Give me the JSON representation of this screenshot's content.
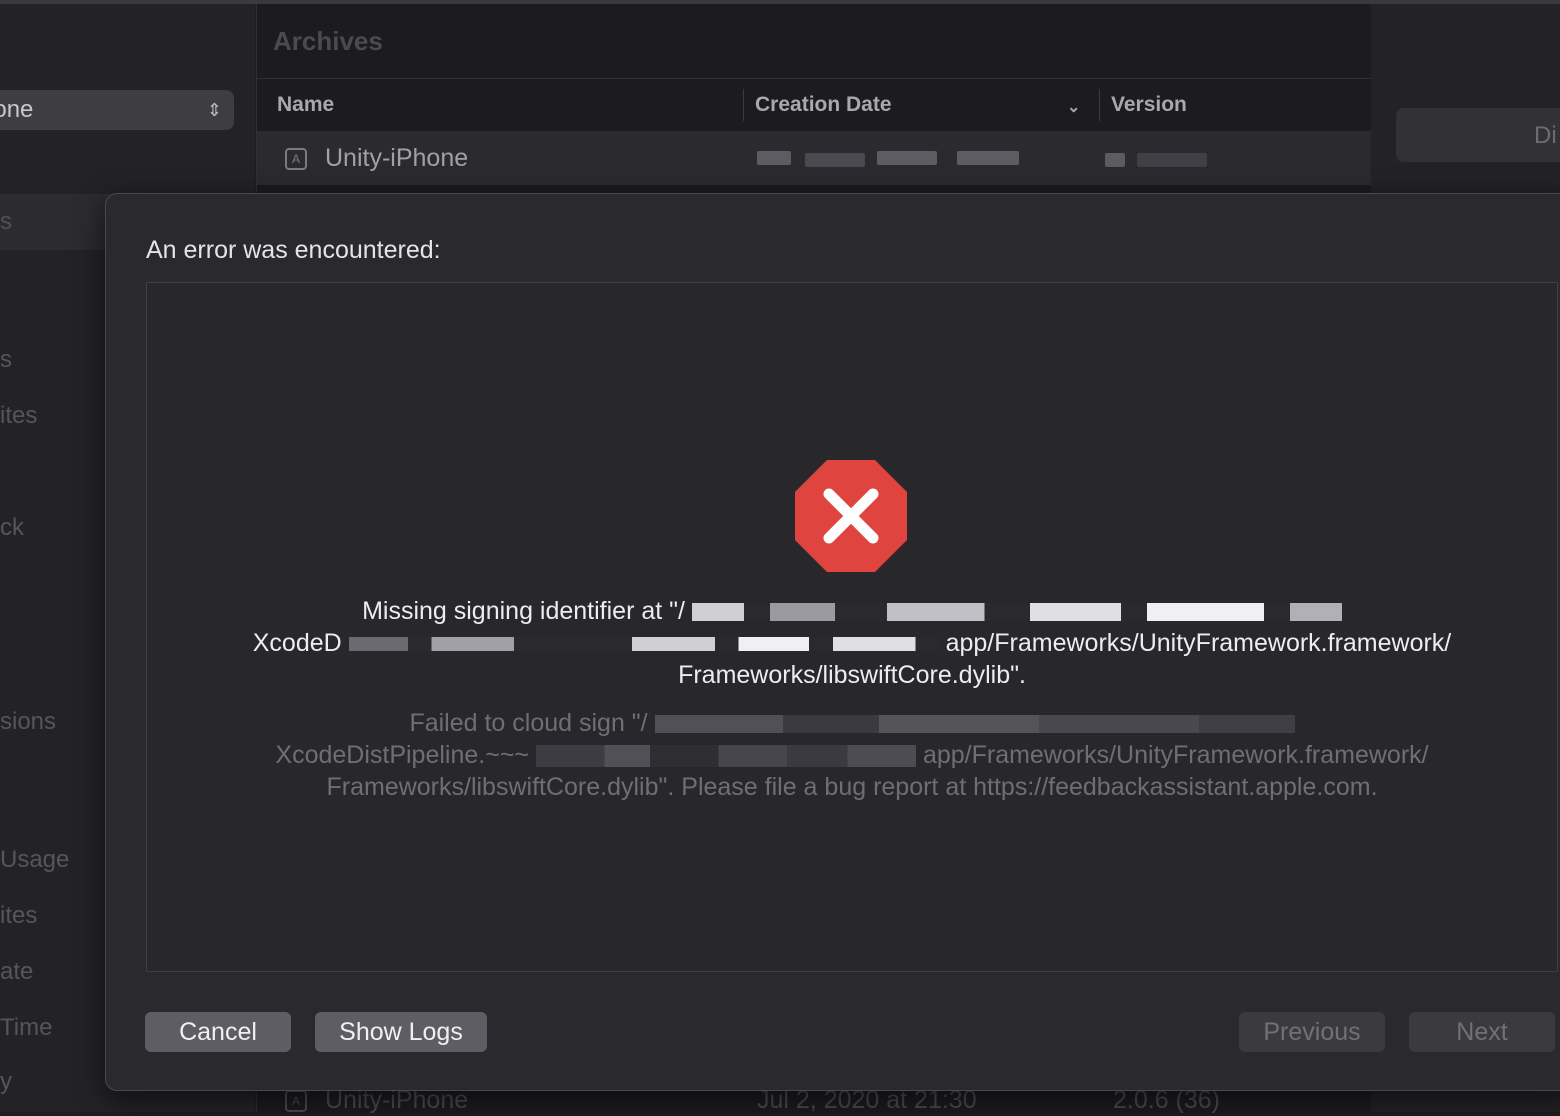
{
  "sidebar": {
    "device": "hone",
    "items": [
      {
        "label": "s"
      },
      {
        "label": "s"
      },
      {
        "label": "ites"
      },
      {
        "label": "ck"
      },
      {
        "label": "sions"
      },
      {
        "label": " Usage"
      },
      {
        "label": "ites"
      },
      {
        "label": "ate"
      },
      {
        "label": " Time"
      },
      {
        "label": "y"
      }
    ]
  },
  "archives": {
    "title": "Archives",
    "columns": {
      "name": "Name",
      "date": "Creation Date",
      "version": "Version"
    },
    "rows": [
      {
        "name": "Unity-iPhone",
        "date": "",
        "version": ""
      },
      {
        "name": "Unity-iPhone",
        "date": "Jul 2, 2020 at 21:30",
        "version": "2.0.6 (36)"
      }
    ]
  },
  "right_panel": {
    "button_label": "Di"
  },
  "sheet": {
    "title": "An error was encountered:",
    "icon": "error-stop-icon",
    "primary_message": "Missing signing identifier at \"/…/XcodeD…app/Frameworks/UnityFramework.framework/Frameworks/libswiftCore.dylib\".",
    "primary_lines": [
      "Missing signing identifier at \"/",
      "XcodeD",
      "app/Frameworks/UnityFramework.framework/",
      "Frameworks/libswiftCore.dylib\"."
    ],
    "secondary_lines": [
      "Failed to cloud sign \"/",
      "XcodeDistPipeline.~~~",
      "app/Frameworks/UnityFramework.framework/",
      "Frameworks/libswiftCore.dylib\". Please file a bug report at https://feedbackassistant.apple.com."
    ],
    "buttons": {
      "cancel": "Cancel",
      "show_logs": "Show Logs",
      "previous": "Previous",
      "next": "Next"
    }
  },
  "colors": {
    "error_red": "#e0443e",
    "sheet_bg": "#2a2a2e",
    "button_bg": "#5d5d63"
  }
}
